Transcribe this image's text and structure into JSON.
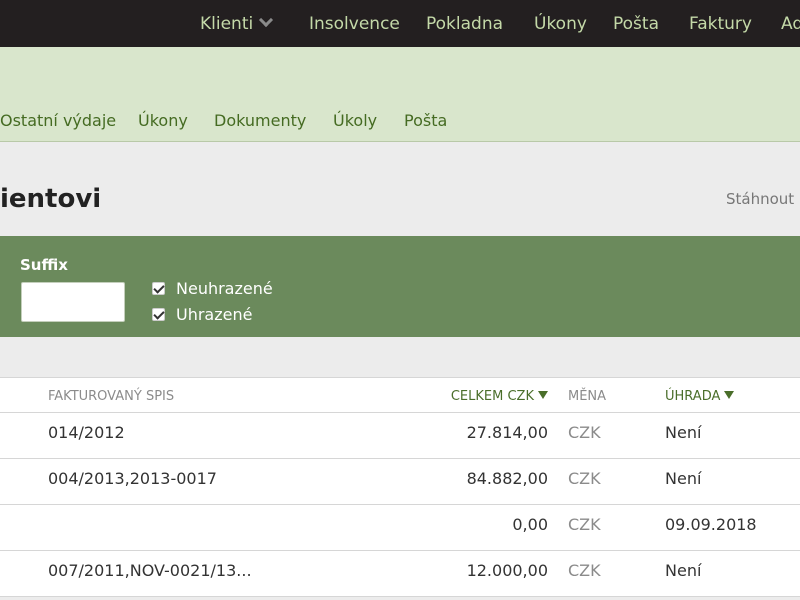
{
  "topnav": {
    "items": [
      "Klienti",
      "Insolvence",
      "Pokladna",
      "Úkony",
      "Pošta",
      "Faktury",
      "Ad"
    ]
  },
  "subnav": {
    "items": [
      "Ostatní výdaje",
      "Úkony",
      "Dokumenty",
      "Úkoly",
      "Pošta"
    ]
  },
  "page": {
    "title": "ientovi",
    "download_label": "Stáhnout"
  },
  "filters": {
    "suffix_label": "Suffix",
    "suffix_value": "",
    "unpaid_label": "Neuhrazené",
    "unpaid_checked": true,
    "paid_label": "Uhrazené",
    "paid_checked": true
  },
  "table": {
    "headers": {
      "spis": "FAKTUROVANÝ SPIS",
      "celkem": "CELKEM CZK",
      "mena": "MĚNA",
      "uhrada": "ÚHRADA"
    },
    "rows": [
      {
        "spis": "014/2012",
        "celkem": "27.814,00",
        "mena": "CZK",
        "uhrada": "Není"
      },
      {
        "spis": "004/2013,2013-0017",
        "celkem": "84.882,00",
        "mena": "CZK",
        "uhrada": "Není"
      },
      {
        "spis": "",
        "celkem": "0,00",
        "mena": "CZK",
        "uhrada": "09.09.2018"
      },
      {
        "spis": "007/2011,NOV-0021/13...",
        "celkem": "12.000,00",
        "mena": "CZK",
        "uhrada": "Není"
      }
    ]
  },
  "colors": {
    "topnav_bg": "#231f20",
    "topnav_text": "#c4d9a8",
    "band_bg": "#d9e6cc",
    "filters_bg": "#6b8a5c",
    "accent_green": "#4a6e2a"
  }
}
